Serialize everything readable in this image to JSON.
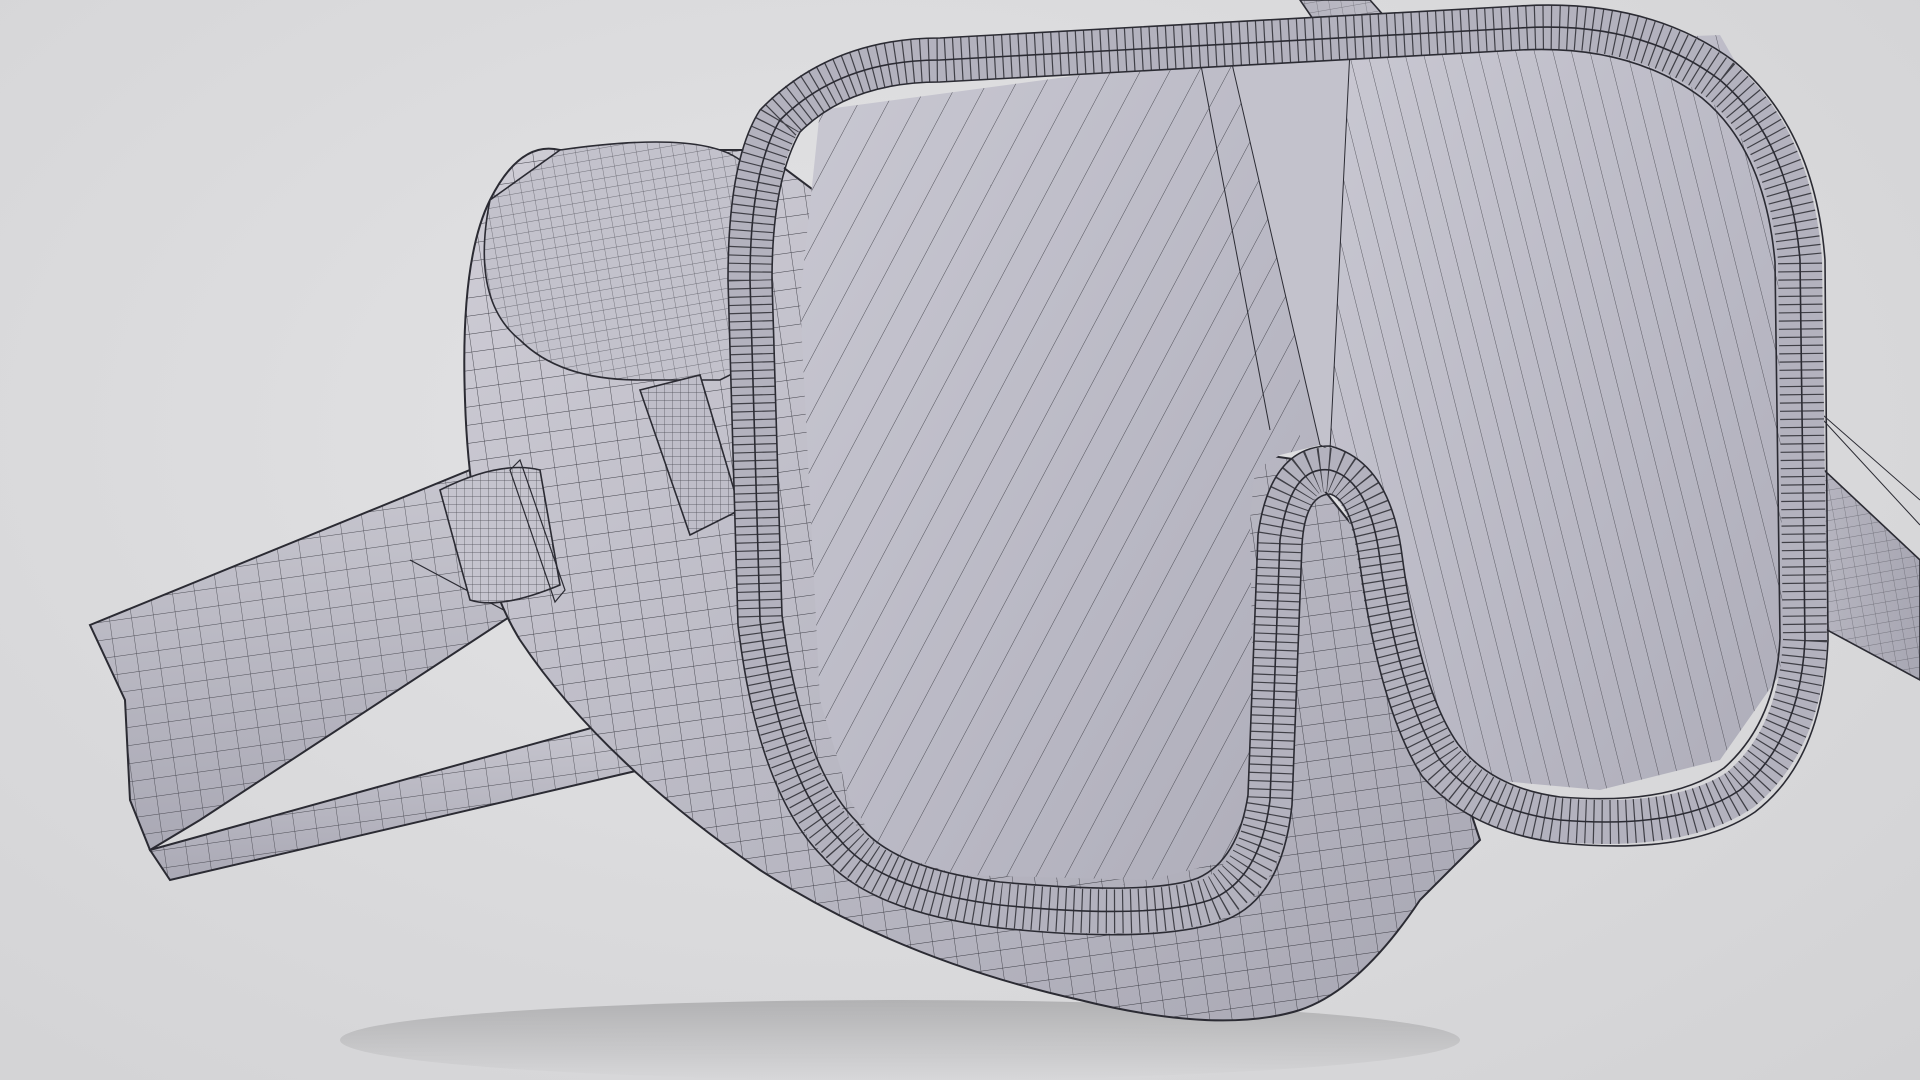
{
  "scene": {
    "subject": "dive-mask-snorkel",
    "display_mode": "wireframe-on-shaded",
    "colors": {
      "background": "#dcdcdc",
      "surface_light": "#c8c7d0",
      "surface_mid": "#b6b5c0",
      "surface_dark": "#9c9ba8",
      "wire": "#2b2b33"
    }
  }
}
